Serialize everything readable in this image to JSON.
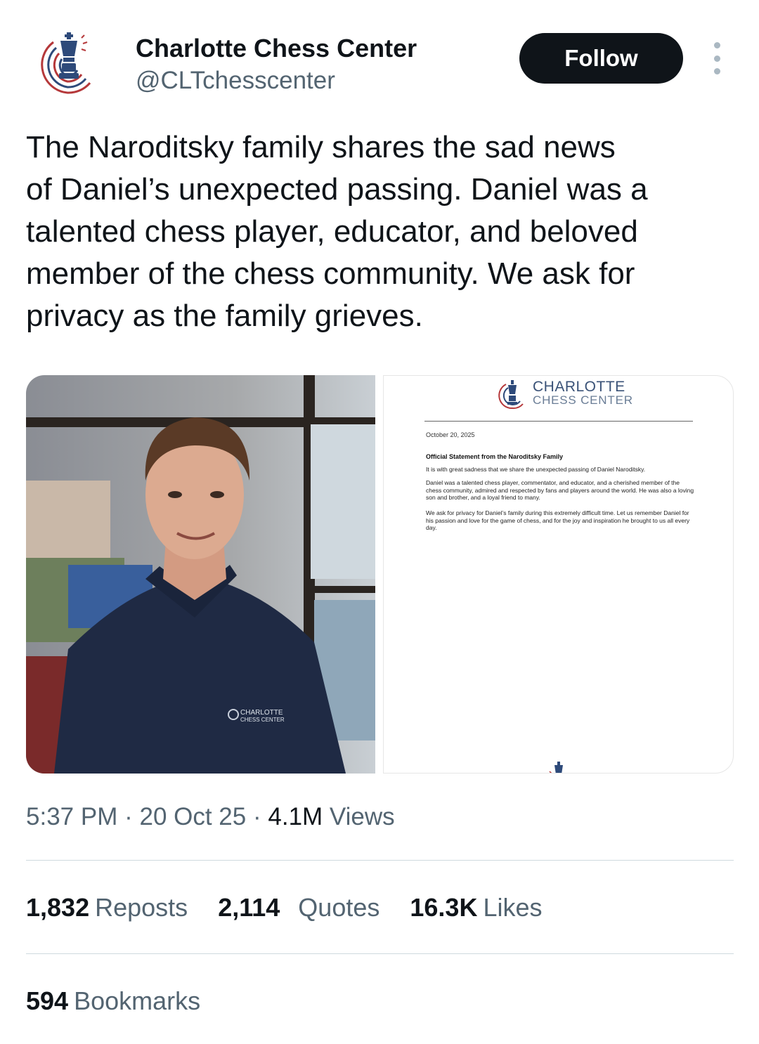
{
  "account": {
    "name": "Charlotte Chess Center",
    "handle": "@CLTchesscenter",
    "avatar_icon": "chess-king-logo-icon"
  },
  "actions": {
    "follow_label": "Follow",
    "more_icon": "more-vertical-icon"
  },
  "tweet": {
    "lines": [
      "The Naroditsky family shares the sad news",
      "of Daniel’s unexpected passing. Daniel was a",
      "talented chess player, educator, and beloved",
      "member of the chess community. We ask for",
      "privacy as the family grieves."
    ]
  },
  "media": {
    "photo_shirt_logo_line1": "CHARLOTTE",
    "photo_shirt_logo_line2": "CHESS CENTER",
    "document": {
      "brand_line1": "CHARLOTTE",
      "brand_line2": "CHESS CENTER",
      "date": "October 20, 2025",
      "heading": "Official Statement from the Naroditsky Family",
      "paragraph1": "It is with great sadness that we share the unexpected passing of Daniel Naroditsky.",
      "paragraph2": "Daniel was a talented chess player, commentator, and educator, and a cherished member of the chess community, admired and respected by fans and players around the world. He was also a loving son and brother, and a loyal friend to many.",
      "paragraph3": "We ask for privacy for Daniel’s family during this extremely difficult time. Let us remember Daniel for his passion and love for the game of chess, and for the joy and inspiration he brought to us all every day."
    }
  },
  "meta": {
    "time": "5:37 PM",
    "separator": "·",
    "date": "20 Oct 25",
    "views_count": "4.1M",
    "views_label": "Views"
  },
  "stats": {
    "reposts_count": "1,832",
    "reposts_label": "Reposts",
    "quotes_count": "2,114",
    "quotes_label": "Quotes",
    "likes_count": "16.3K",
    "likes_label": "Likes",
    "bookmarks_count": "594",
    "bookmarks_label": "Bookmarks"
  },
  "colors": {
    "text_primary": "#0f1419",
    "text_secondary": "#536471",
    "follow_bg": "#0f1419",
    "divider": "#cfd9de",
    "logo_navy": "#2e4a7a",
    "logo_red": "#b5383a"
  }
}
